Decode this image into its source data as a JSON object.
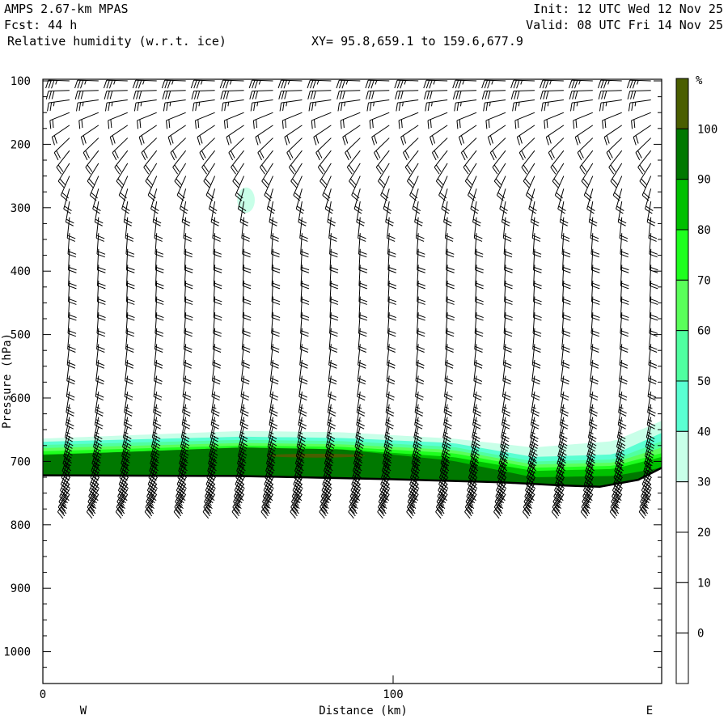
{
  "header": {
    "model": "AMPS 2.67-km MPAS",
    "forecast": "Fcst:   44 h",
    "field": "Relative humidity (w.r.t. ice)",
    "xy": "XY=  95.8,659.1 to 159.6,677.9",
    "init": "Init: 12 UTC Wed 12 Nov 25",
    "valid": "Valid: 08 UTC Fri 14 Nov 25"
  },
  "chart_data": {
    "type": "heatmap",
    "title": "Relative humidity (w.r.t. ice)",
    "xlabel": "Distance (km)",
    "ylabel": "Pressure (hPa)",
    "xlim": [
      0,
      176.7
    ],
    "ylim": [
      1050,
      100
    ],
    "x_ticks": [
      "0",
      "100"
    ],
    "x_tick_values": [
      0,
      100
    ],
    "y_ticks": [
      "100",
      "200",
      "300",
      "400",
      "500",
      "600",
      "700",
      "800",
      "900",
      "1000"
    ],
    "y_tick_values": [
      100,
      200,
      300,
      400,
      500,
      600,
      700,
      800,
      900,
      1000
    ],
    "west_label": "W",
    "east_label": "E",
    "colorbar": {
      "unit": "%",
      "labels": [
        "100",
        "90",
        "80",
        "70",
        "60",
        "50",
        "40",
        "30",
        "20",
        "10",
        "0"
      ],
      "levels": [
        -10,
        0,
        10,
        20,
        30,
        40,
        50,
        60,
        70,
        80,
        90,
        100,
        110
      ],
      "colors": [
        "#ffffff",
        "#ffffff",
        "#ffffff",
        "#ffffff",
        "#c8ffe8",
        "#5affd2",
        "#50ffa0",
        "#5aff5a",
        "#1eff1e",
        "#00c000",
        "#007800",
        "#4a5e00"
      ]
    },
    "terrain": {
      "km": [
        0,
        55,
        99,
        131,
        149,
        159,
        170,
        176.7
      ],
      "pressure": [
        722,
        723,
        728,
        733,
        738,
        740,
        729,
        710
      ]
    },
    "rh_bands": {
      "km": [
        0,
        57,
        85,
        117,
        140,
        163,
        176.7
      ],
      "bands": [
        {
          "min": 30,
          "top_pressure": [
            664,
            652,
            654,
            664,
            678,
            668,
            636
          ]
        },
        {
          "min": 40,
          "top_pressure": [
            669,
            661,
            663,
            671,
            693,
            689,
            655
          ]
        },
        {
          "min": 50,
          "top_pressure": [
            674,
            666,
            668,
            677,
            700,
            697,
            668
          ]
        },
        {
          "min": 60,
          "top_pressure": [
            679,
            671,
            673,
            682,
            705,
            702,
            678
          ]
        },
        {
          "min": 70,
          "top_pressure": [
            684,
            675,
            677,
            687,
            710,
            707,
            687
          ]
        },
        {
          "min": 80,
          "top_pressure": [
            689,
            680,
            681,
            693,
            715,
            712,
            693
          ]
        },
        {
          "min": 90,
          "top_pressure": [
            690,
            678,
            681,
            699,
            725,
            723,
            710
          ]
        }
      ],
      "blobs": [
        {
          "min": 30,
          "km": 58,
          "pressure": 288,
          "dkm": 2.5,
          "dp": 10
        },
        {
          "min": 100,
          "km": 78,
          "pressure": 691,
          "dkm": 14,
          "dp": 1.5
        }
      ]
    },
    "wind_columns_km": [
      7.6,
      15.9,
      24.2,
      32.5,
      40.8,
      49.1,
      57.4,
      65.7,
      74.0,
      82.3,
      90.6,
      98.9,
      107.2,
      115.5,
      123.8,
      132.1,
      140.4,
      148.7,
      157.0,
      165.3,
      173.6
    ],
    "wind_profile": {
      "pressure": [
        100,
        115,
        130,
        150,
        170,
        190,
        210,
        230,
        250,
        270,
        290,
        315,
        340,
        365,
        390,
        415,
        440,
        465,
        490,
        515,
        540,
        565,
        590,
        610,
        630,
        645,
        660,
        672,
        684,
        695,
        706,
        716,
        726,
        735,
        744,
        752
      ],
      "direction_deg": [
        272,
        268,
        262,
        248,
        236,
        226,
        218,
        212,
        204,
        196,
        190,
        186,
        184,
        183,
        183,
        183,
        183,
        184,
        185,
        186,
        187,
        188,
        189,
        190,
        192,
        194,
        196,
        198,
        200,
        202,
        204,
        206,
        208,
        210,
        212,
        214
      ],
      "speed_kt": [
        35,
        30,
        25,
        22,
        20,
        20,
        20,
        20,
        22,
        20,
        20,
        20,
        20,
        20,
        20,
        20,
        20,
        20,
        20,
        20,
        22,
        22,
        25,
        25,
        28,
        30,
        30,
        32,
        35,
        35,
        38,
        40,
        40,
        40,
        38,
        35
      ]
    }
  }
}
